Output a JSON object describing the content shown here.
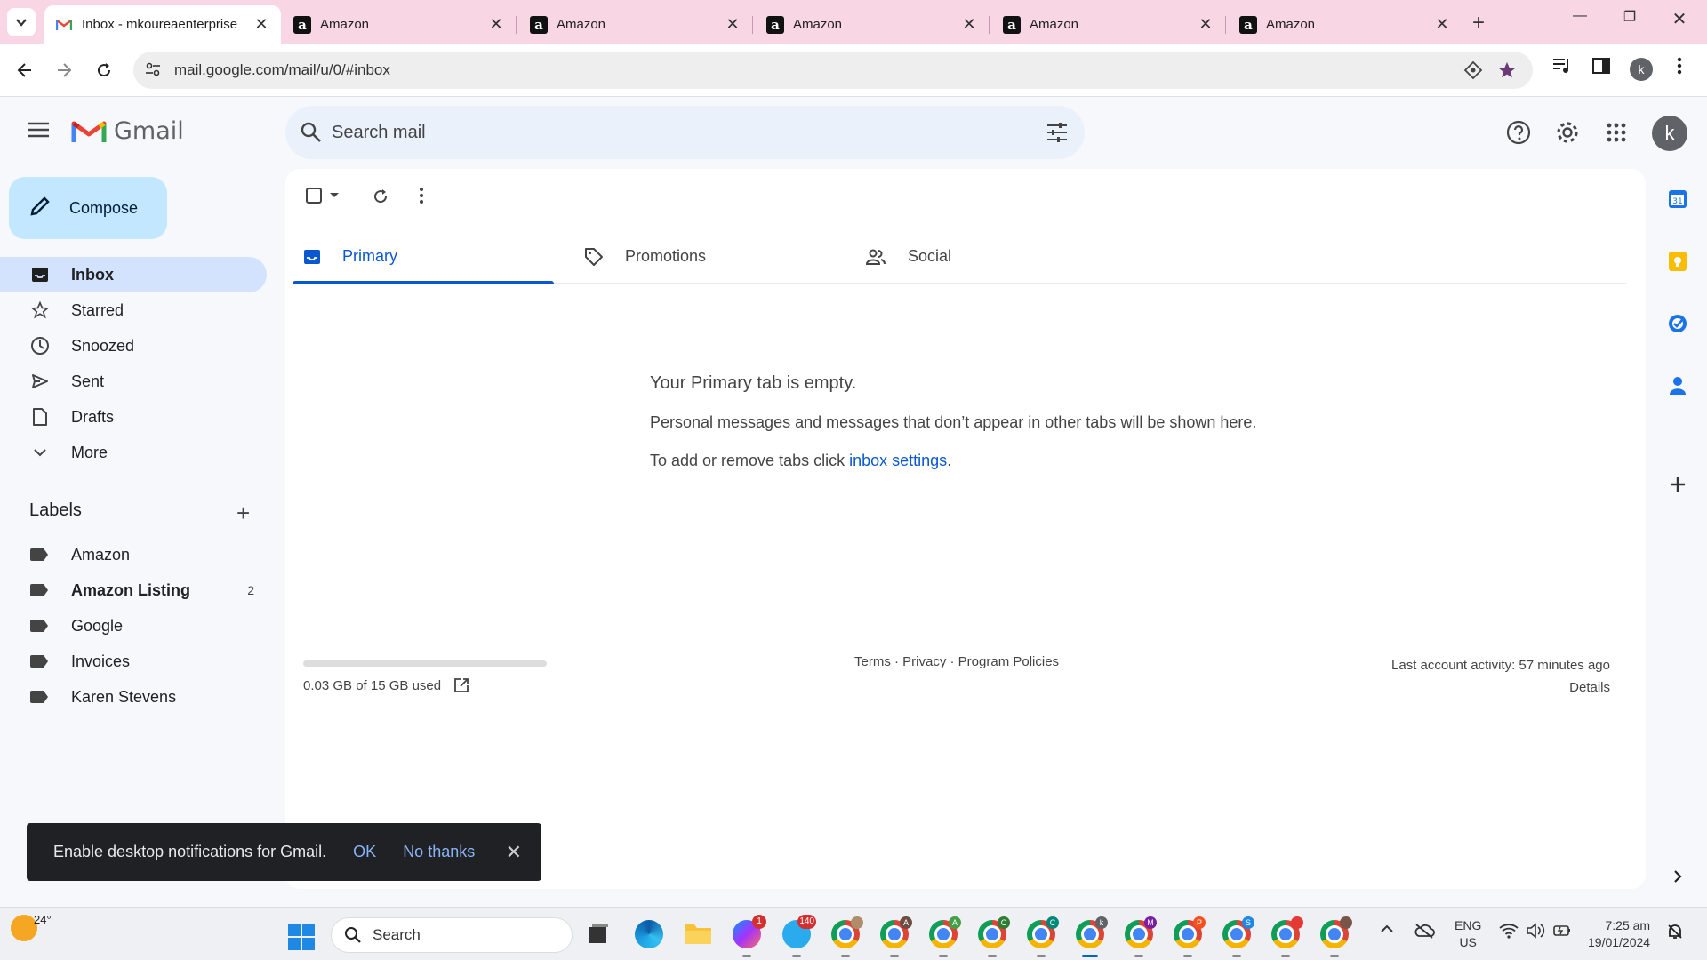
{
  "browser": {
    "tabs": [
      {
        "title": "Inbox - mkoureaenterprise",
        "active": true,
        "favicon": "gmail-icon"
      },
      {
        "title": "Amazon",
        "active": false,
        "favicon": "amazon-icon"
      },
      {
        "title": "Amazon",
        "active": false,
        "favicon": "amazon-icon"
      },
      {
        "title": "Amazon",
        "active": false,
        "favicon": "amazon-icon"
      },
      {
        "title": "Amazon",
        "active": false,
        "favicon": "amazon-icon"
      },
      {
        "title": "Amazon",
        "active": false,
        "favicon": "amazon-icon"
      }
    ],
    "url": "mail.google.com/mail/u/0/#inbox",
    "profile_initial": "k"
  },
  "gmail": {
    "logo_text": "Gmail",
    "search_placeholder": "Search mail",
    "account_initial": "k",
    "compose_label": "Compose",
    "nav": [
      {
        "label": "Inbox",
        "icon": "inbox-icon",
        "active": true
      },
      {
        "label": "Starred",
        "icon": "star-icon"
      },
      {
        "label": "Snoozed",
        "icon": "clock-icon"
      },
      {
        "label": "Sent",
        "icon": "send-icon"
      },
      {
        "label": "Drafts",
        "icon": "draft-icon"
      },
      {
        "label": "More",
        "icon": "chevron-down-icon"
      }
    ],
    "labels_title": "Labels",
    "labels": [
      {
        "name": "Amazon",
        "bold": false,
        "count": ""
      },
      {
        "name": "Amazon Listing",
        "bold": true,
        "count": "2"
      },
      {
        "name": "Google",
        "bold": false,
        "count": ""
      },
      {
        "name": "Invoices",
        "bold": false,
        "count": ""
      },
      {
        "name": "Karen Stevens",
        "bold": false,
        "count": ""
      }
    ],
    "category_tabs": [
      {
        "label": "Primary",
        "icon": "inbox-tab-icon",
        "active": true
      },
      {
        "label": "Promotions",
        "icon": "tag-icon",
        "active": false
      },
      {
        "label": "Social",
        "icon": "people-icon",
        "active": false
      }
    ],
    "empty_state": {
      "title": "Your Primary tab is empty.",
      "line1": "Personal messages and messages that don’t appear in other tabs will be shown here.",
      "line2_prefix": "To add or remove tabs click ",
      "line2_link": "inbox settings",
      "line2_suffix": "."
    },
    "storage": {
      "text": "0.03 GB of 15 GB used",
      "fraction": 0.002
    },
    "footer_links": "Terms · Privacy · Program Policies",
    "last_activity": "Last account activity: 57 minutes ago",
    "details_link": "Details",
    "snackbar": {
      "message": "Enable desktop notifications for Gmail.",
      "ok": "OK",
      "no_thanks": "No thanks"
    }
  },
  "taskbar": {
    "temperature": "24°",
    "search_label": "Search",
    "language_top": "ENG",
    "language_bottom": "US",
    "time": "7:25 am",
    "date": "19/01/2024",
    "badges": {
      "messenger": "1",
      "telegram": "140"
    },
    "chrome_profiles": [
      "A",
      "A",
      "C",
      "C",
      "k",
      "M",
      "P",
      "S"
    ]
  },
  "colors": {
    "accent": "#0b57d0",
    "compose_bg": "#c2e7ff",
    "active_nav_bg": "#d3e3fd",
    "tabstrip_bg": "#f8d6e4"
  }
}
